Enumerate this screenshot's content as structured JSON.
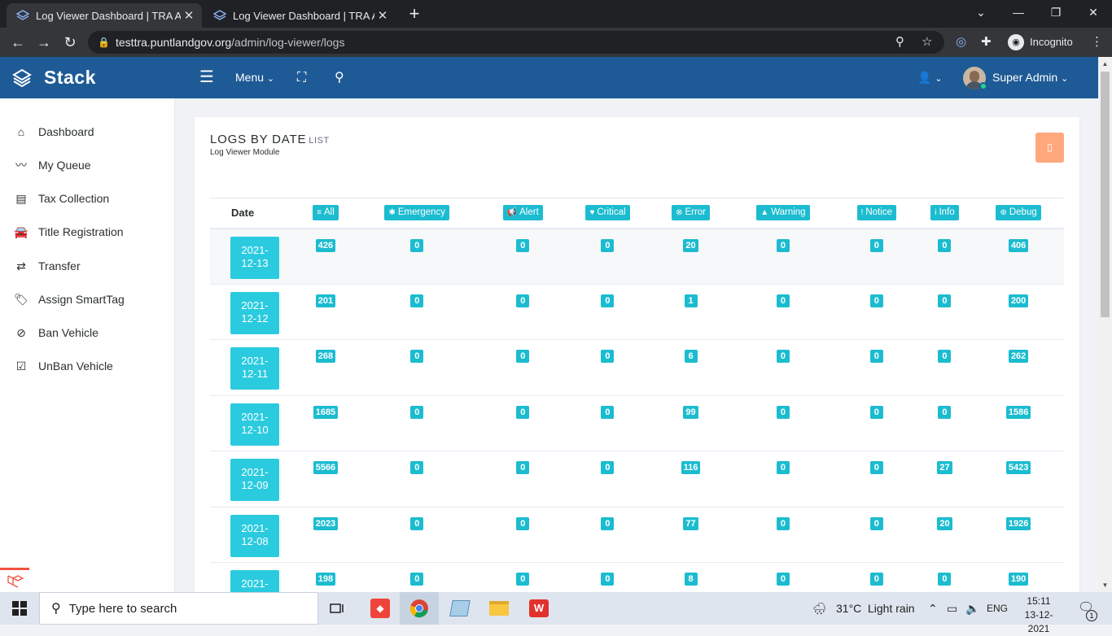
{
  "browser": {
    "tabs": [
      {
        "title": "Log Viewer Dashboard | TRA App",
        "close": "✕"
      },
      {
        "title": "Log Viewer Dashboard | TRA App",
        "close": "✕"
      }
    ],
    "url_host": "testtra.puntlandgov.org",
    "url_path": "/admin/log-viewer/logs",
    "incognito_label": "Incognito"
  },
  "header": {
    "brand": "Stack",
    "menu_label": "Menu",
    "user_name": "Super Admin"
  },
  "sidebar": {
    "items": [
      {
        "label": "Dashboard",
        "icon": "home-icon"
      },
      {
        "label": "My Queue",
        "icon": "trend-icon"
      },
      {
        "label": "Tax Collection",
        "icon": "list-icon"
      },
      {
        "label": "Title Registration",
        "icon": "car-icon"
      },
      {
        "label": "Transfer",
        "icon": "exchange-icon"
      },
      {
        "label": "Assign SmartTag",
        "icon": "tags-icon"
      },
      {
        "label": "Ban Vehicle",
        "icon": "ban-icon"
      },
      {
        "label": "UnBan Vehicle",
        "icon": "check-square-icon"
      }
    ]
  },
  "card": {
    "title": "LOGS BY DATE",
    "title_small": "LIST",
    "subtitle": "Log Viewer Module",
    "action_glyph": "▯"
  },
  "table": {
    "date_header": "Date",
    "levels": [
      {
        "label": "All",
        "icon": "≡"
      },
      {
        "label": "Emergency",
        "icon": "✱"
      },
      {
        "label": "Alert",
        "icon": "📢"
      },
      {
        "label": "Critical",
        "icon": "♥"
      },
      {
        "label": "Error",
        "icon": "⊗"
      },
      {
        "label": "Warning",
        "icon": "▲"
      },
      {
        "label": "Notice",
        "icon": "!"
      },
      {
        "label": "Info",
        "icon": "i"
      },
      {
        "label": "Debug",
        "icon": "⊕"
      }
    ],
    "rows": [
      {
        "date_a": "2021-",
        "date_b": "12-13",
        "counts": [
          "426",
          "0",
          "0",
          "0",
          "20",
          "0",
          "0",
          "0",
          "406"
        ]
      },
      {
        "date_a": "2021-",
        "date_b": "12-12",
        "counts": [
          "201",
          "0",
          "0",
          "0",
          "1",
          "0",
          "0",
          "0",
          "200"
        ]
      },
      {
        "date_a": "2021-",
        "date_b": "12-11",
        "counts": [
          "268",
          "0",
          "0",
          "0",
          "6",
          "0",
          "0",
          "0",
          "262"
        ]
      },
      {
        "date_a": "2021-",
        "date_b": "12-10",
        "counts": [
          "1685",
          "0",
          "0",
          "0",
          "99",
          "0",
          "0",
          "0",
          "1586"
        ]
      },
      {
        "date_a": "2021-",
        "date_b": "12-09",
        "counts": [
          "5566",
          "0",
          "0",
          "0",
          "116",
          "0",
          "0",
          "27",
          "5423"
        ]
      },
      {
        "date_a": "2021-",
        "date_b": "12-08",
        "counts": [
          "2023",
          "0",
          "0",
          "0",
          "77",
          "0",
          "0",
          "20",
          "1926"
        ]
      },
      {
        "date_a": "2021-",
        "date_b": "",
        "counts": [
          "198",
          "0",
          "0",
          "0",
          "8",
          "0",
          "0",
          "0",
          "190"
        ]
      }
    ]
  },
  "taskbar": {
    "search_placeholder": "Type here to search",
    "weather_temp": "31°C",
    "weather_desc": "Light rain",
    "language": "ENG",
    "time": "15:11",
    "date": "13-12-2021",
    "notification_count": "1"
  },
  "colors": {
    "header_bg": "#1e5a95",
    "badge": "#1cbcd0",
    "date_badge": "#2bcbdf",
    "action_btn": "#ffa87d"
  }
}
